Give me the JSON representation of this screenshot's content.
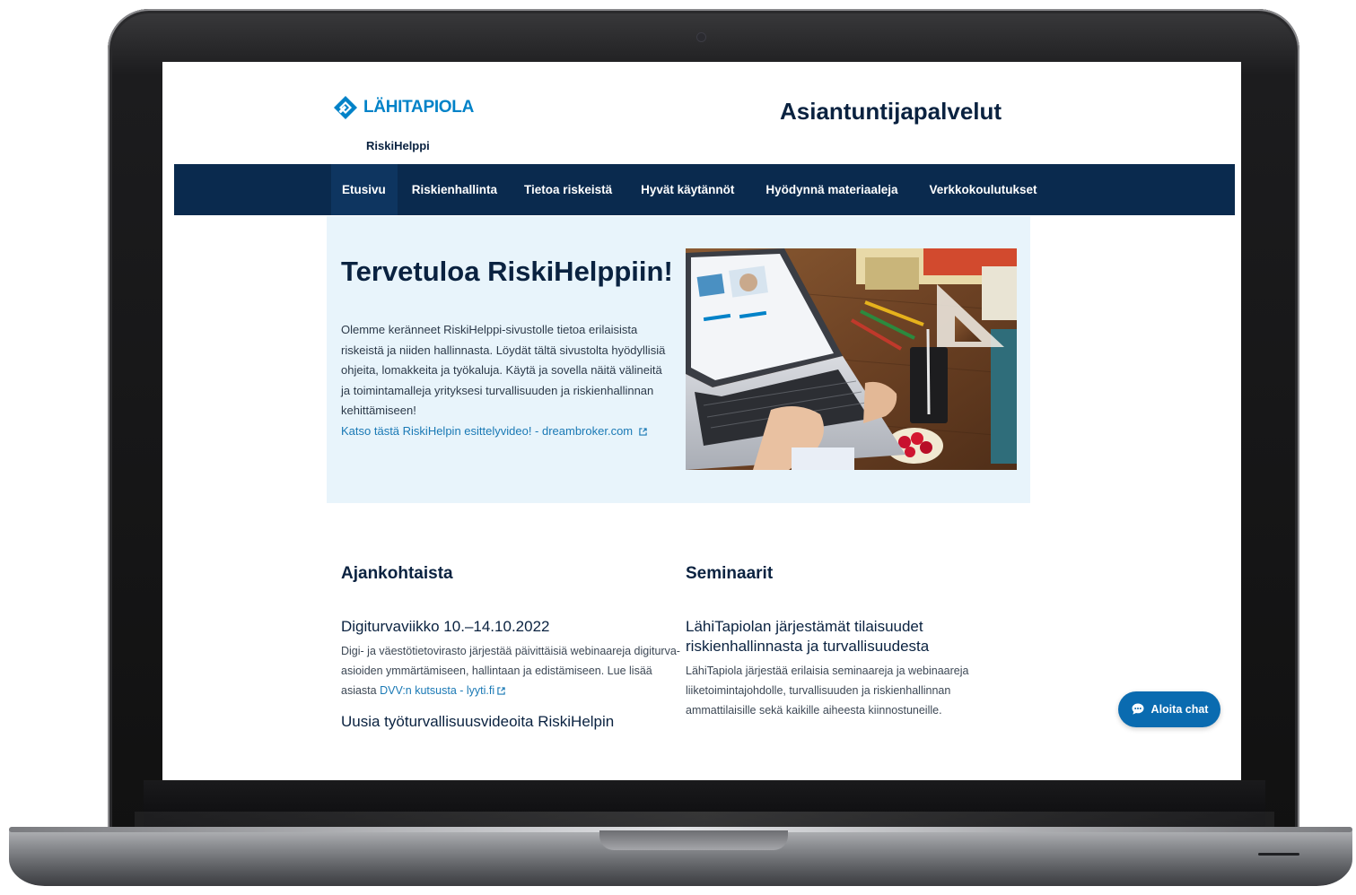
{
  "brand": {
    "logo_text": "LÄHITAPIOLA",
    "sub_title": "RiskiHelppi",
    "site_title": "Asiantuntijapalvelut",
    "colors": {
      "primary_navy": "#0a2a4e",
      "accent_blue": "#0082c8",
      "hero_bg": "#e8f4fb",
      "link": "#1a79b5"
    }
  },
  "nav": {
    "items": [
      {
        "label": "Etusivu",
        "active": true
      },
      {
        "label": "Riskienhallinta"
      },
      {
        "label": "Tietoa riskeistä"
      },
      {
        "label": "Hyvät käytännöt"
      },
      {
        "label": "Hyödynnä materiaaleja"
      },
      {
        "label": "Verkkokoulutukset"
      }
    ]
  },
  "hero": {
    "title": "Tervetuloa RiskiHelppiin!",
    "body": "Olemme keränneet RiskiHelppi-sivustolle tietoa erilaisista riskeistä ja niiden hallinnasta. Löydät tältä sivustolta hyödyllisiä ohjeita, lomakkeita ja työkaluja. Käytä ja sovella näitä välineitä ja toimintamalleja yrityksesi turvallisuuden ja riskienhallinnan kehittämiseen!",
    "link_text": "Katso tästä RiskiHelpin esittelyvideo! - dreambroker.com",
    "image": "laptop-on-desk-photo"
  },
  "news": {
    "heading": "Ajankohtaista",
    "items": [
      {
        "title": "Digiturvaviikko 10.–14.10.2022",
        "text": "Digi- ja väestötietovirasto järjestää päivittäisiä webinaareja digiturva-asioiden ymmärtämiseen, hallintaan ja edistämiseen. Lue lisää asiasta ",
        "link": "DVV:n kutsusta - lyyti.fi"
      },
      {
        "title": "Uusia työturvallisuusvideoita RiskiHelpin"
      }
    ]
  },
  "seminars": {
    "heading": "Seminaarit",
    "items": [
      {
        "title": "LähiTapiolan järjestämät tilaisuudet riskienhallinnasta ja turvallisuudesta",
        "text": "LähiTapiola järjestää erilaisia seminaareja ja webinaareja liiketoimintajohdolle, turvallisuuden ja riskienhallinnan ammattilaisille sekä kaikille aiheesta kiinnostuneille."
      }
    ]
  },
  "chat": {
    "label": "Aloita chat",
    "icon": "chat-bubble-icon"
  }
}
